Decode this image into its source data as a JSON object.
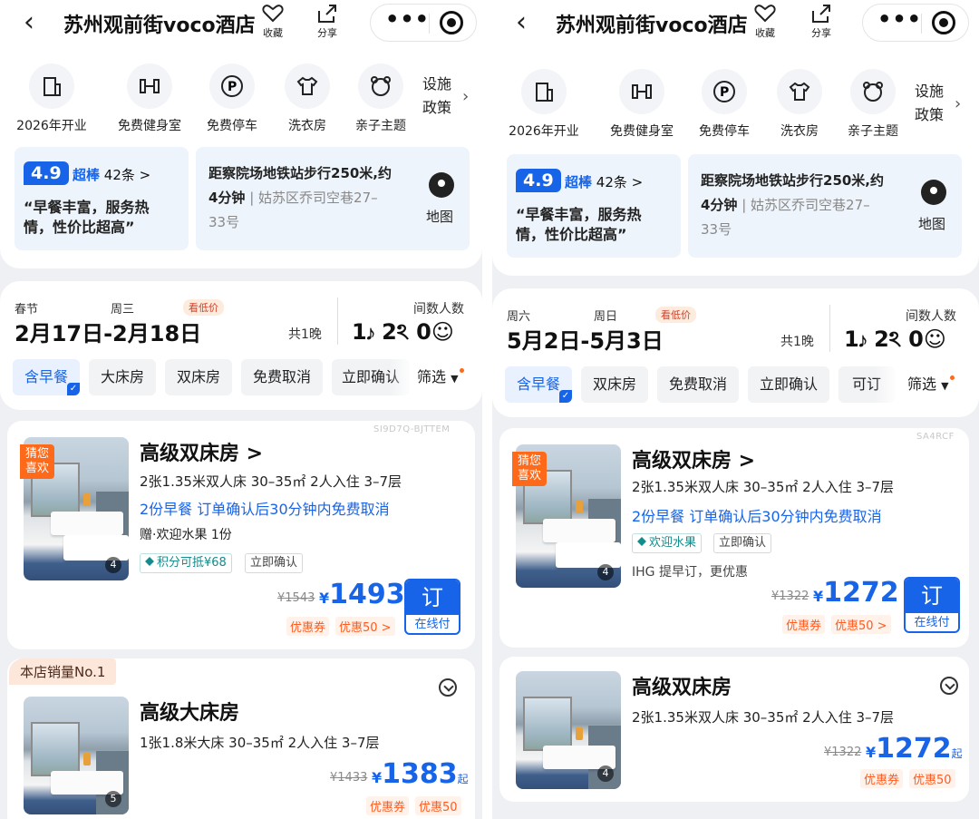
{
  "left": {
    "hotel_title": "苏州观前街voco酒店",
    "top_actions": {
      "favorite": "收藏",
      "share": "分享"
    },
    "facilities": [
      "2026年开业",
      "免费健身室",
      "免费停车",
      "洗衣房",
      "亲子主题"
    ],
    "policy": [
      "设施",
      "政策"
    ],
    "rating": {
      "score": "4.9",
      "level": "超棒",
      "count": "42条 >",
      "quote": [
        "“早餐丰富，服务热",
        "情，性价比超高”"
      ]
    },
    "address": {
      "line1": "距察院场地铁站步行250米,约",
      "line2a": "4分钟",
      "line2b": " | 姑苏区乔司空巷27–",
      "line3": "33号",
      "map": "地图"
    },
    "date": {
      "festival": "春节",
      "weekday": "周三",
      "low_price": "看低价",
      "range": "2月17日-2月18日",
      "nights": "共1晚",
      "guest_label": "间数人数",
      "guests": "1𝆕 2ঽ 0☺"
    },
    "chips": [
      "含早餐",
      "大床房",
      "双床房",
      "免费取消",
      "立即确认"
    ],
    "filter": "筛选",
    "card1": {
      "code": "SI9D7Q-BJTTEM",
      "badge": [
        "猜您",
        "喜欢"
      ],
      "photo_count": "4",
      "name": "高级双床房 >",
      "spec": "2张1.35米双人床  30–35㎡  2人入住  3–7层",
      "breakfast": "2份早餐  订单确认后30分钟内免费取消",
      "gift": "赠·欢迎水果 1份",
      "tag1": "积分可抵¥68",
      "tag2": "立即确认",
      "orig": "¥1543",
      "yen": "¥",
      "price": "1493",
      "coupons": [
        "优惠券",
        "优惠50 >"
      ],
      "book": [
        "订",
        "在线付"
      ]
    },
    "card2": {
      "sales": "本店销量No.1",
      "photo_count": "5",
      "name": "高级大床房",
      "spec": "1张1.8米大床  30–35㎡  2人入住  3–7层",
      "orig": "¥1433",
      "yen": "¥",
      "price": "1383",
      "qi": "起",
      "coupons": [
        "优惠券",
        "优惠50"
      ]
    }
  },
  "right": {
    "hotel_title": "苏州观前街voco酒店",
    "top_actions": {
      "favorite": "收藏",
      "share": "分享"
    },
    "facilities": [
      "2026年开业",
      "免费健身室",
      "免费停车",
      "洗衣房",
      "亲子主题"
    ],
    "policy": [
      "设施",
      "政策"
    ],
    "rating": {
      "score": "4.9",
      "level": "超棒",
      "count": "42条 >",
      "quote": [
        "“早餐丰富，服务热",
        "情，性价比超高”"
      ]
    },
    "address": {
      "line1": "距察院场地铁站步行250米,约",
      "line2a": "4分钟",
      "line2b": " | 姑苏区乔司空巷27–",
      "line3": "33号",
      "map": "地图"
    },
    "date": {
      "festival": "周六",
      "weekday": "周日",
      "low_price": "看低价",
      "range": "5月2日-5月3日",
      "nights": "共1晚",
      "guest_label": "间数人数",
      "guests": "1𝆕 2ঽ 0☺"
    },
    "chips": [
      "含早餐",
      "双床房",
      "免费取消",
      "立即确认",
      "可订"
    ],
    "filter": "筛选",
    "card1": {
      "code": "SA4RCF",
      "badge": [
        "猜您",
        "喜欢"
      ],
      "photo_count": "4",
      "name": "高级双床房 >",
      "spec": "2张1.35米双人床  30–35㎡  2人入住  3–7层",
      "breakfast": "2份早餐  订单确认后30分钟内免费取消",
      "tag1": "欢迎水果",
      "tag2": "立即确认",
      "ihg": "IHG 提早订，更优惠",
      "orig": "¥1322",
      "yen": "¥",
      "price": "1272",
      "coupons": [
        "优惠券",
        "优惠50 >"
      ],
      "book": [
        "订",
        "在线付"
      ]
    },
    "card2": {
      "photo_count": "4",
      "name": "高级双床房",
      "spec": "2张1.35米双人床  30–35㎡  2人入住  3–7层",
      "orig": "¥1322",
      "yen": "¥",
      "price": "1272",
      "qi": "起",
      "coupons": [
        "优惠券",
        "优惠50"
      ]
    }
  }
}
